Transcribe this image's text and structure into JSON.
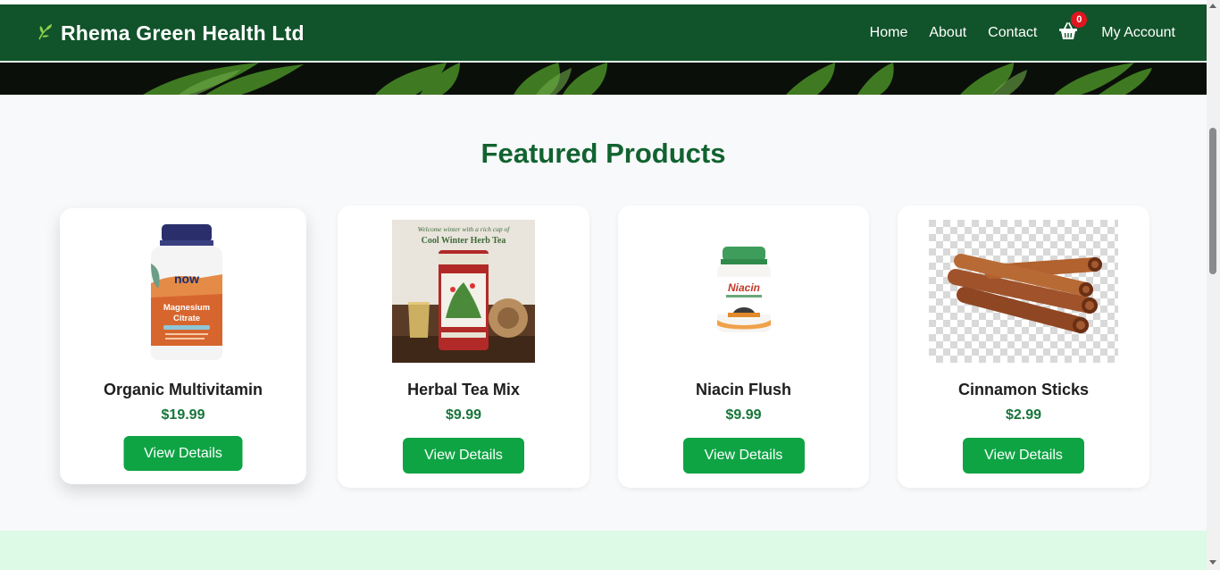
{
  "navbar": {
    "brand_icon": "leaf-icon",
    "brand": "Rhema Green Health Ltd",
    "links": [
      "Home",
      "About",
      "Contact"
    ],
    "cart_icon": "basket-icon",
    "cart_count": "0",
    "account": "My Account"
  },
  "colors": {
    "nav_bg": "#11532a",
    "title": "#11632f",
    "price": "#17753a",
    "button": "#0ea444",
    "badge": "#e0151f",
    "next_section_bg": "#dcfae5"
  },
  "featured": {
    "title": "Featured Products",
    "products": [
      {
        "name": "Organic Multivitamin",
        "price": "$19.99",
        "button": "View Details",
        "image_icon": "supplement-bottle-image"
      },
      {
        "name": "Herbal Tea Mix",
        "price": "$9.99",
        "button": "View Details",
        "image_icon": "tea-tin-image",
        "image_text": [
          "Welcome winter with a rich cup of",
          "Cool Winter Herb Tea"
        ]
      },
      {
        "name": "Niacin Flush",
        "price": "$9.99",
        "button": "View Details",
        "image_icon": "supplement-jar-image"
      },
      {
        "name": "Cinnamon Sticks",
        "price": "$2.99",
        "button": "View Details",
        "image_icon": "cinnamon-image"
      }
    ]
  }
}
